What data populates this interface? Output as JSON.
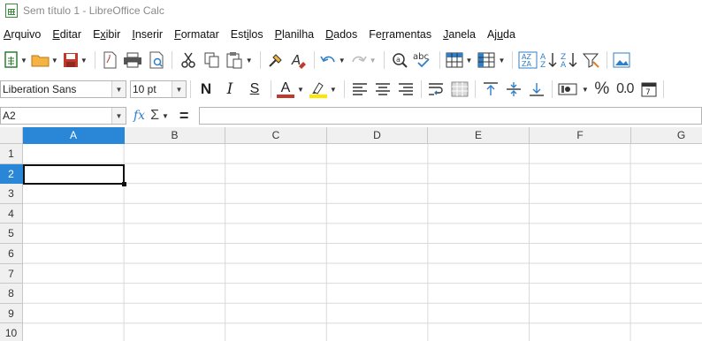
{
  "window": {
    "title": "Sem título 1 - LibreOffice Calc"
  },
  "menu": [
    {
      "pre": "",
      "acc": "A",
      "post": "rquivo"
    },
    {
      "pre": "",
      "acc": "E",
      "post": "ditar"
    },
    {
      "pre": "E",
      "acc": "x",
      "post": "ibir"
    },
    {
      "pre": "",
      "acc": "I",
      "post": "nserir"
    },
    {
      "pre": "",
      "acc": "F",
      "post": "ormatar"
    },
    {
      "pre": "Est",
      "acc": "i",
      "post": "los"
    },
    {
      "pre": "",
      "acc": "P",
      "post": "lanilha"
    },
    {
      "pre": "",
      "acc": "D",
      "post": "ados"
    },
    {
      "pre": "Fe",
      "acc": "r",
      "post": "ramentas"
    },
    {
      "pre": "",
      "acc": "J",
      "post": "anela"
    },
    {
      "pre": "Aj",
      "acc": "u",
      "post": "da"
    }
  ],
  "formatting": {
    "font_name": "Liberation Sans",
    "font_size": "10 pt",
    "bold": "N",
    "italic": "I",
    "underline": "S",
    "font_color_letter": "A",
    "percent": "%",
    "decimal": "0.0",
    "font_color": "#c0392b",
    "highlight_color": "#ffe600"
  },
  "formula_bar": {
    "name_box": "A2",
    "fx": "fx",
    "sigma": "Σ",
    "equals": "=",
    "content": ""
  },
  "sheet": {
    "columns": [
      "A",
      "B",
      "C",
      "D",
      "E",
      "F",
      "G"
    ],
    "rows": [
      "1",
      "2",
      "3",
      "4",
      "5",
      "6",
      "7",
      "8",
      "9",
      "10"
    ],
    "active_column": "A",
    "active_row": "2",
    "accent": "#2a86d6"
  }
}
